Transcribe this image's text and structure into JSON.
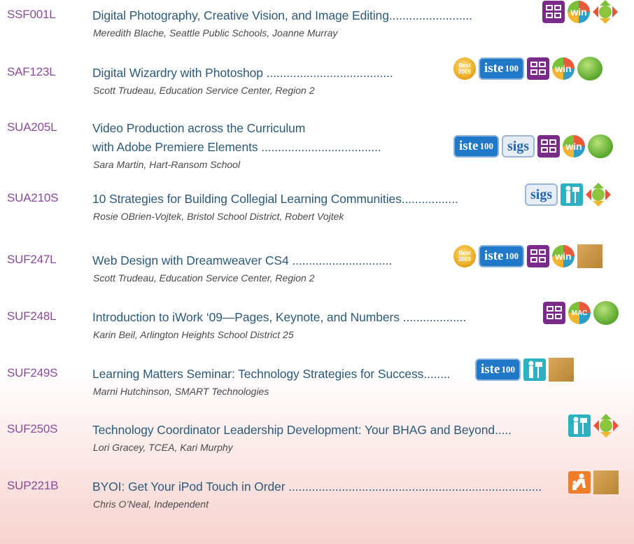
{
  "sessions": [
    {
      "code": "SSF001L",
      "title_lines": [
        "Digital Photography, Creative Vision, and Image Editing"
      ],
      "dots": ".........................",
      "speaker": "Meredith Blache, Seattle Public Schools, Joanne Murray",
      "icons": [
        "lab-icon",
        "win-icon",
        "diamond-icon"
      ]
    },
    {
      "code": "SAF123L",
      "title_lines": [
        "Digital Wizardry with Photoshop"
      ],
      "dots": " ......................................",
      "speaker": "Scott Trudeau, Education Service Center, Region 2",
      "icons": [
        "best-2009-icon",
        "iste100-icon",
        "lab-icon",
        "win-icon",
        "circle-icon"
      ]
    },
    {
      "code": "SUA205L",
      "title_lines": [
        "Video Production across the Curriculum",
        "with Adobe Premiere Elements"
      ],
      "dots": " ....................................",
      "speaker": "Sara Martin, Hart-Ransom School",
      "icons": [
        "iste100-icon",
        "sigs-icon",
        "lab-icon",
        "win-icon",
        "circle-icon"
      ]
    },
    {
      "code": "SUA210S",
      "title_lines": [
        "10 Strategies for Building Collegial Learning Communities"
      ],
      "dots": ".................",
      "speaker": "Rosie OBrien-Vojtek, Bristol School District, Robert Vojtek",
      "icons": [
        "sigs-icon",
        "person-icon",
        "diamond-icon"
      ]
    },
    {
      "code": "SUF247L",
      "title_lines": [
        "Web Design with Dreamweaver CS4"
      ],
      "dots": " ..............................",
      "speaker": "Scott Trudeau, Education Service Center, Region 2",
      "icons": [
        "best-2009-icon",
        "iste100-icon",
        "lab-icon",
        "win-icon",
        "square-icon"
      ]
    },
    {
      "code": "SUF248L",
      "title_lines": [
        "Introduction to iWork ‘09—Pages, Keynote, and Numbers"
      ],
      "dots": " ...................",
      "speaker": "Karin Beil, Arlington Heights School District 25",
      "icons": [
        "lab-icon",
        "mac-icon",
        "circle-icon"
      ]
    },
    {
      "code": "SUF249S",
      "title_lines": [
        "Learning Matters Seminar: Technology Strategies for Success"
      ],
      "dots": "........",
      "speaker": "Marni Hutchinson, SMART Technologies",
      "icons": [
        "iste100-icon",
        "person-icon",
        "square-icon"
      ]
    },
    {
      "code": "SUF250S",
      "title_lines": [
        "Technology Coordinator Leadership Development: Your BHAG and Beyond"
      ],
      "dots": ".....",
      "speaker": "Lori Gracey, TCEA, Kari Murphy",
      "icons": [
        "person-icon",
        "diamond-icon"
      ]
    },
    {
      "code": "SUP221B",
      "title_lines": [
        "BYOI: Get Your iPod Touch in Order"
      ],
      "dots": " ............................................................................",
      "speaker": "Chris O’Neal, Independent",
      "icons": [
        "kids-icon",
        "square-icon"
      ]
    }
  ],
  "icon_labels": {
    "win": "win",
    "mac": "MAC",
    "iste": "iste",
    "iste_num": "100",
    "sigs": "sigs",
    "best_word": "Best",
    "best_year": "2009"
  },
  "colors": {
    "code": "#8a4a9a",
    "title": "#2d5a78",
    "speaker": "#4a4a4a",
    "lab": "#7a2b8a"
  }
}
